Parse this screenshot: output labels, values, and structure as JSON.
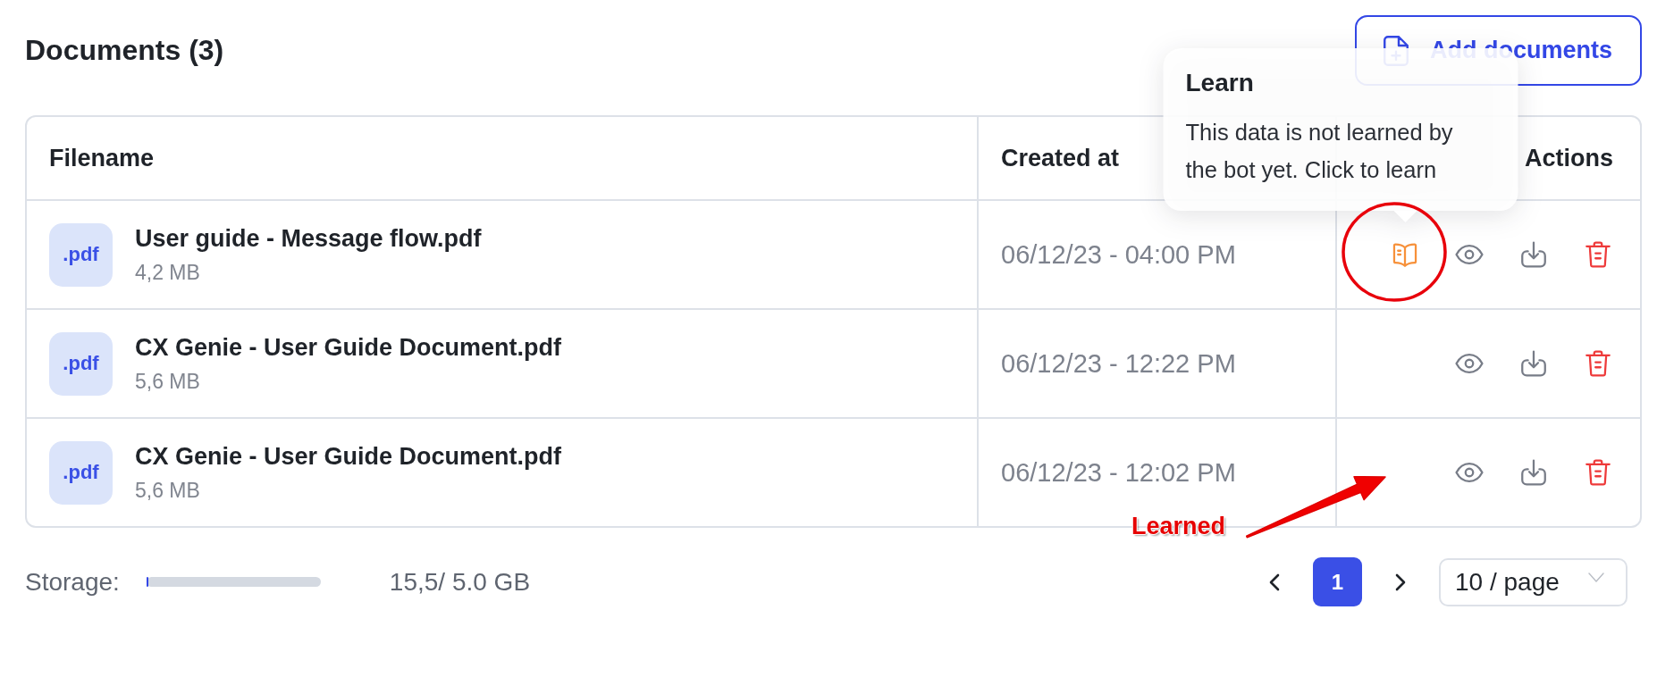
{
  "header": {
    "title": "Documents (3)",
    "add_button": "Add documents"
  },
  "table": {
    "columns": [
      "Filename",
      "Created at",
      "Actions"
    ],
    "rows": [
      {
        "file_type": ".pdf",
        "filename": "User guide - Message flow.pdf",
        "size": "4,2 MB",
        "created_at": "06/12/23 - 04:00 PM",
        "learned": false,
        "tooltip": {
          "title": "Learn",
          "text": "This data is not learned by the bot yet. Click to learn"
        }
      },
      {
        "file_type": ".pdf",
        "filename": "CX Genie - User Guide Document.pdf",
        "size": "5,6 MB",
        "created_at": "06/12/23 - 12:22 PM",
        "learned": true
      },
      {
        "file_type": ".pdf",
        "filename": "CX Genie - User Guide Document.pdf",
        "size": "5,6 MB",
        "created_at": "06/12/23 - 12:02 PM",
        "learned": true
      }
    ]
  },
  "footer": {
    "storage_label": "Storage:",
    "storage": {
      "level": 0.01
    },
    "storage_text": "15,5/ 5.0 GB",
    "pages": [
      {
        "label": "1",
        "selected": true
      }
    ],
    "page_size": "10 / page"
  },
  "annotations": [
    {
      "kind": "circle"
    },
    {
      "kind": "arrow",
      "label": "Learned"
    }
  ]
}
